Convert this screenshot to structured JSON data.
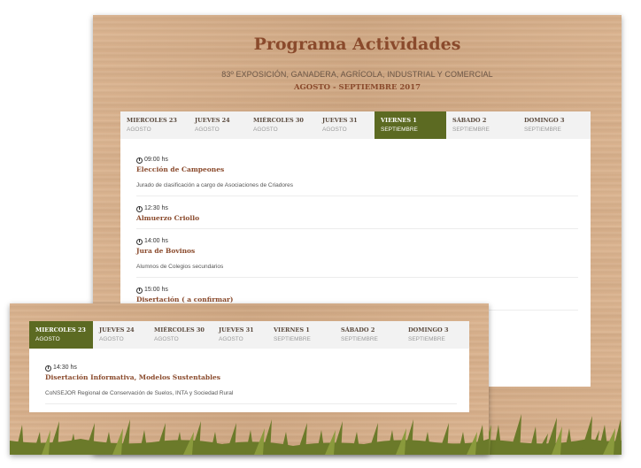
{
  "back": {
    "title": "Programa Actividades",
    "subtitle": "83º EXPOSICIÓN, GANADERA, AGRÍCOLA, INDUSTRIAL Y COMERCIAL",
    "dates": "AGOSTO - SEPTIEMBRE 2017",
    "tabs": [
      {
        "day": "MIERCOLES 23",
        "month": "AGOSTO"
      },
      {
        "day": "JUEVES 24",
        "month": "AGOSTO"
      },
      {
        "day": "MIÉRCOLES 30",
        "month": "AGOSTO"
      },
      {
        "day": "JUEVES 31",
        "month": "AGOSTO"
      },
      {
        "day": "VIERNES 1",
        "month": "SEPTIEMBRE"
      },
      {
        "day": "SÁBADO 2",
        "month": "SEPTIEMBRE"
      },
      {
        "day": "DOMINGO 3",
        "month": "SEPTIEMBRE"
      }
    ],
    "active_tab": 4,
    "events": [
      {
        "time": "09:00 hs",
        "title": "Elección de Campeones",
        "desc": "Jurado de clasificación a cargo de Asociaciones de Criadores"
      },
      {
        "time": "12:30 hs",
        "title": "Almuerzo Criollo",
        "desc": ""
      },
      {
        "time": "14:00 hs",
        "title": "Jura de Bovinos",
        "desc": "Alumnos de Colegios secundarios"
      },
      {
        "time": "15:00 hs",
        "title": "Disertación ( a confirmar)",
        "desc": ""
      }
    ]
  },
  "front": {
    "tabs": [
      {
        "day": "MIERCOLES 23",
        "month": "AGOSTO"
      },
      {
        "day": "JUEVES 24",
        "month": "AGOSTO"
      },
      {
        "day": "MIÉRCOLES 30",
        "month": "AGOSTO"
      },
      {
        "day": "JUEVES 31",
        "month": "AGOSTO"
      },
      {
        "day": "VIERNES 1",
        "month": "SEPTIEMBRE"
      },
      {
        "day": "SÁBADO 2",
        "month": "SEPTIEMBRE"
      },
      {
        "day": "DOMINGO 3",
        "month": "SEPTIEMBRE"
      }
    ],
    "active_tab": 0,
    "events": [
      {
        "time": "14:30 hs",
        "title": "Disertación Informativa, Modelos Sustentables",
        "desc": "CoNSEJOR Regional de Conservación de Suelos, INTA y Sociedad Rural"
      }
    ]
  },
  "colors": {
    "accent": "#5c6a22",
    "title": "#8a4a2c",
    "grass": "#6b7a2a"
  }
}
